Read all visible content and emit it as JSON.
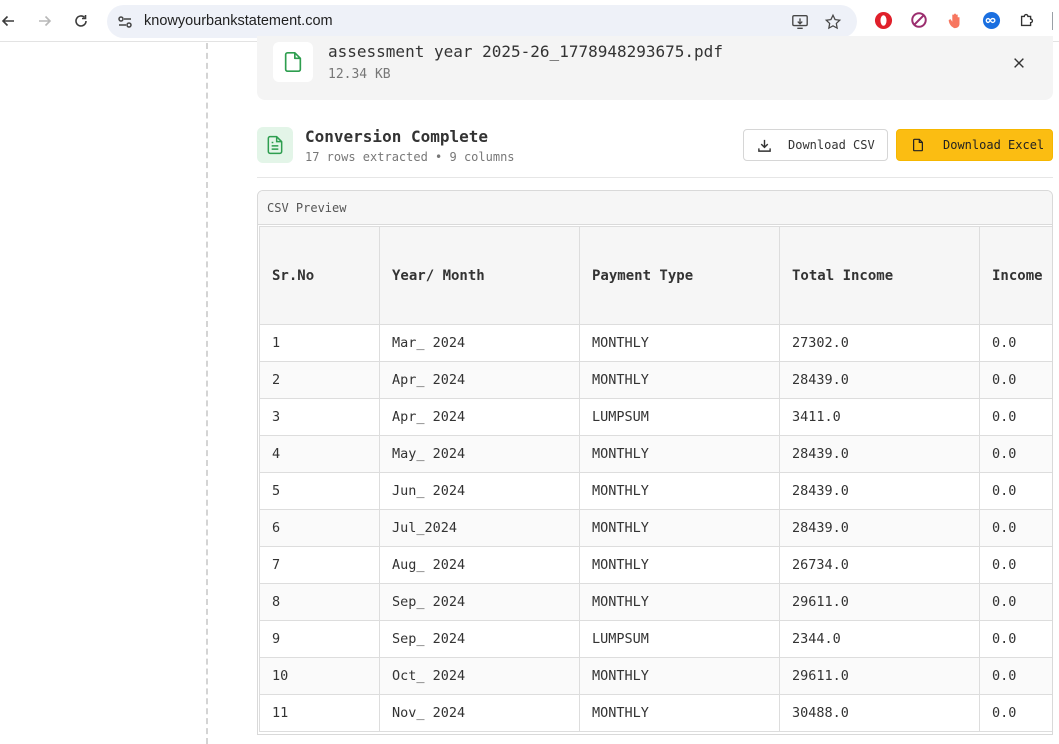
{
  "browser": {
    "url": "knowyourbankstatement.com",
    "icons": [
      "back-icon",
      "forward-icon",
      "reload-icon",
      "site-settings-icon",
      "install-app-icon",
      "bookmark-star-icon"
    ],
    "extensions": [
      "opera-ext-icon",
      "block-ext-icon",
      "hand-ext-icon",
      "infinity-ext-icon",
      "puzzle-extensions-icon"
    ]
  },
  "file": {
    "name": "assessment year 2025-26_1778948293675.pdf",
    "size": "12.34 KB"
  },
  "conversion": {
    "title": "Conversion Complete",
    "subtitle": "17 rows extracted • 9 columns",
    "download_csv": "Download CSV",
    "download_excel": "Download Excel"
  },
  "preview": {
    "label": "CSV Preview",
    "headers": [
      "Sr.No",
      "Year/ Month",
      "Payment Type",
      "Total Income",
      "Income"
    ],
    "rows": [
      [
        "1",
        "Mar_ 2024",
        "MONTHLY",
        "27302.0",
        "0.0"
      ],
      [
        "2",
        "Apr_ 2024",
        "MONTHLY",
        "28439.0",
        "0.0"
      ],
      [
        "3",
        "Apr_ 2024",
        "LUMPSUM",
        "3411.0",
        "0.0"
      ],
      [
        "4",
        "May_ 2024",
        "MONTHLY",
        "28439.0",
        "0.0"
      ],
      [
        "5",
        "Jun_ 2024",
        "MONTHLY",
        "28439.0",
        "0.0"
      ],
      [
        "6",
        "Jul_2024",
        "MONTHLY",
        "28439.0",
        "0.0"
      ],
      [
        "7",
        "Aug_ 2024",
        "MONTHLY",
        "26734.0",
        "0.0"
      ],
      [
        "8",
        "Sep_ 2024",
        "MONTHLY",
        "29611.0",
        "0.0"
      ],
      [
        "9",
        "Sep_ 2024",
        "LUMPSUM",
        "2344.0",
        "0.0"
      ],
      [
        "10",
        "Oct_ 2024",
        "MONTHLY",
        "29611.0",
        "0.0"
      ],
      [
        "11",
        "Nov_ 2024",
        "MONTHLY",
        "30488.0",
        "0.0"
      ]
    ]
  },
  "colors": {
    "accent": "#fbbd12",
    "success": "#2e9e4f",
    "success_bg": "#e3f5e8"
  }
}
